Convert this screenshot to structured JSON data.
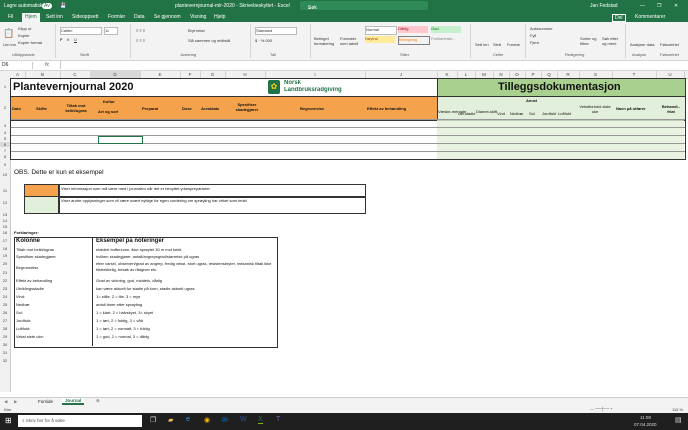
{
  "window": {
    "autosave": "Lagre automatisk",
    "autosave_state": "Av",
    "filename": "plantevernjournal-mlr-2020 - Skrivebeskyttet - Excel",
    "search_placeholder": "Søk",
    "user": "Jan Fedstad"
  },
  "ribbon": {
    "tabs": [
      "Fil",
      "Hjem",
      "Sett inn",
      "Sideoppsett",
      "Formler",
      "Data",
      "Se gjennom",
      "Visning",
      "Hjelp"
    ],
    "share": "Del",
    "comments": "Kommentarer",
    "clipboard": {
      "paste": "Lim inn",
      "cut": "Klipp ut",
      "copy": "Kopier",
      "format_painter": "Kopier format",
      "group": "Utklippstavle"
    },
    "font": {
      "name": "Calibri",
      "size": "11",
      "group": "Skrift"
    },
    "alignment": {
      "wrap": "Bryt tekst",
      "merge": "Slå sammen og midtstill",
      "group": "Justering"
    },
    "number": {
      "format": "Standard",
      "group": "Tall"
    },
    "styles": {
      "conditional": "Betinget formatering",
      "table": "Formater som tabell",
      "normal": "Normal",
      "bad": "Dårlig",
      "good": "God",
      "neutral": "Nøytral",
      "calculation": "Beregning",
      "explanatory": "Forklarende...",
      "group": "Stiler"
    },
    "cells": {
      "insert": "Sett inn",
      "delete": "Slett",
      "format": "Format",
      "group": "Celler"
    },
    "editing": {
      "autosum": "Autosummer",
      "fill": "Fyll",
      "clear": "Fjern",
      "sort": "Sorter og filtrer",
      "find": "Søk etter og merk",
      "group": "Redigering"
    },
    "analysis": {
      "analyze": "Analyser data",
      "group": "Analyse"
    },
    "sensitivity": {
      "label": "Følsomhet",
      "group": "Følsomhet"
    }
  },
  "formula_bar": {
    "name_box": "D6",
    "fx": "fx",
    "value": ""
  },
  "columns": [
    "A",
    "B",
    "C",
    "D",
    "E",
    "F",
    "G",
    "H",
    "I",
    "J",
    "K",
    "L",
    "M",
    "N",
    "O",
    "P",
    "Q",
    "R",
    "S",
    "T",
    "U"
  ],
  "rows": [
    "1",
    "2",
    "3",
    "4",
    "5",
    "6",
    "7",
    "8",
    "9",
    "10",
    "11",
    "12",
    "13",
    "14",
    "15",
    "16",
    "17",
    "18",
    "19",
    "20",
    "21",
    "22",
    "23",
    "24",
    "25",
    "26",
    "27",
    "28",
    "29",
    "30",
    "31",
    "32"
  ],
  "sheet": {
    "title": "Plantevernjournal 2020",
    "logo_line1": "Norsk",
    "logo_line2": "Landbruksrådgiving",
    "tillegg_title": "Tilleggsdokumentasjon",
    "headers": {
      "dato": "Dato",
      "skifte": "Skifte",
      "tiltak": "Tiltak mot beikt/ugras",
      "kultur": "Kultur",
      "art": "Art og sort",
      "preparat": "Preparat",
      "dose": "Dose",
      "areal": "Arealdato",
      "spesifiser": "Spesifiser skadegjører",
      "begrunnelse": "Begrunnelse",
      "effekt": "Effekt av behandling"
    },
    "tillegg_headers": {
      "vaeske": "Væske-mengde",
      "utvstadie": "Utv.stadie",
      "diameter": "Diamet-skift",
      "vind": "Vind",
      "nedbor": "Nedbør",
      "annet": "Annet",
      "sol": "Sol",
      "jordfukt": "Jordfukt",
      "luftfukt": "Luftfukt",
      "vekstforhold": "Vekstforhold siste uke",
      "navn": "Navn på utfører",
      "behandlet": "Behandl.-friat"
    },
    "obs": "OBS. Dette er kun et eksempel",
    "legend_orange": "Viser informasjon som må være med i journalen når det er benyttet yrkesprepararter",
    "legend_green": "Viser andre opplysninger som vil være svært nyttige for egen vurdering om sprøyting har virket som tenkt",
    "forklaringer": "Forklaringer:",
    "kolonne_hdr": "Kolonne",
    "eksempel_hdr": "Eksempel på noteringer",
    "explanations": [
      {
        "k": "Tiltak mot beikt/ugras",
        "v": "etablert bufferzone, ikke sprøytet 30 m mot bekk"
      },
      {
        "k": "Spesifiser skadegjører",
        "v": "hvilken skadegjører, antall/angrepsgrad/størrelse på ugras"
      },
      {
        "k": "Begrunnelse",
        "v": "etter varsel, observert/grad av angrep, fredig vekst, stort ugras, resistensbryter, mekanisk tiltak ikke tilstrekkelig, besøk av rådgiver etc."
      },
      {
        "k": "Effekt av behandling",
        "v": "Grad av virkning, god, middels, dårlig"
      },
      {
        "k": "Utviklingsstadie",
        "v": "kan være aktuelt for stadie på korn, stadie aktuelt ugras"
      },
      {
        "k": "Vind:",
        "v": "1= stille, 2 = lite, 3 = mye"
      },
      {
        "k": "Nedbør:",
        "v": "antall timer etter sprøyting"
      },
      {
        "k": "Sol:",
        "v": "1 = klart, 2 = halvskyet, 3= skyet"
      },
      {
        "k": "Jordfukt:",
        "v": "1 = tørt, 2 = fuktig, 3 = vått"
      },
      {
        "k": "Luftfukt:",
        "v": "1 = tørt, 2 = normalt, 3 = fuktig"
      },
      {
        "k": "Vekst siste uke:",
        "v": "1 = god, 2 = normal, 3 = dårlig"
      }
    ]
  },
  "sheet_tabs": [
    "Forside",
    "Journal"
  ],
  "status": {
    "ready": "Klar",
    "zoom": "115 %"
  },
  "taskbar": {
    "search": "Skriv her for å søke",
    "time": "11:08",
    "date": "07.04.2020"
  },
  "colors": {
    "excel_green": "#217346",
    "orange": "#f4a34c",
    "light_green": "#e2efda",
    "title_green": "#a9d08e"
  }
}
